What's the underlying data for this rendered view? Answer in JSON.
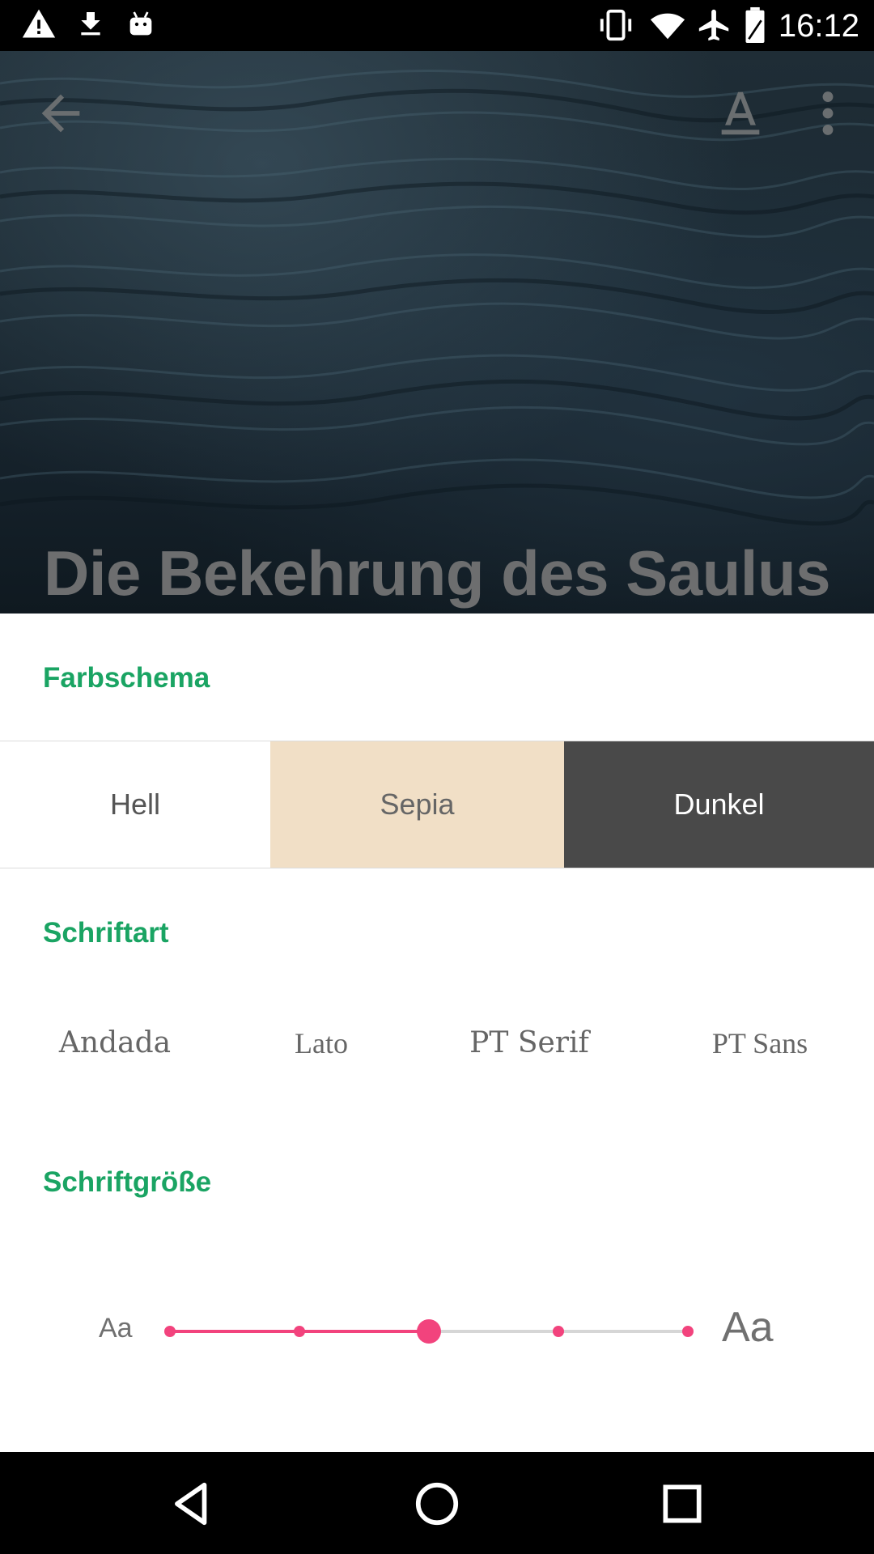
{
  "status_bar": {
    "time": "16:12",
    "left_icons": [
      "warning-icon",
      "download-icon",
      "android-icon"
    ],
    "right_icons": [
      "vibrate-icon",
      "wifi-icon",
      "airplane-icon",
      "battery-icon"
    ]
  },
  "header": {
    "title": "Die Bekehrung des Saulus",
    "actions": [
      "back-arrow-icon",
      "font-format-icon",
      "more-vert-icon"
    ]
  },
  "settings": {
    "color_scheme": {
      "title": "Farbschema",
      "options": [
        "Hell",
        "Sepia",
        "Dunkel"
      ],
      "colors": [
        "#ffffff",
        "#f1dfc6",
        "#494949"
      ]
    },
    "font": {
      "title": "Schriftart",
      "options": [
        "Andada",
        "Lato",
        "PT Serif",
        "PT Sans"
      ]
    },
    "font_size": {
      "title": "Schriftgröße",
      "small_label": "Aa",
      "large_label": "Aa",
      "steps": 5,
      "selected_step": 3,
      "accent_color": "#f2437d"
    }
  },
  "accent_color": "#1aa463",
  "nav_bar": [
    "back-triangle-icon",
    "home-circle-icon",
    "recents-square-icon"
  ]
}
